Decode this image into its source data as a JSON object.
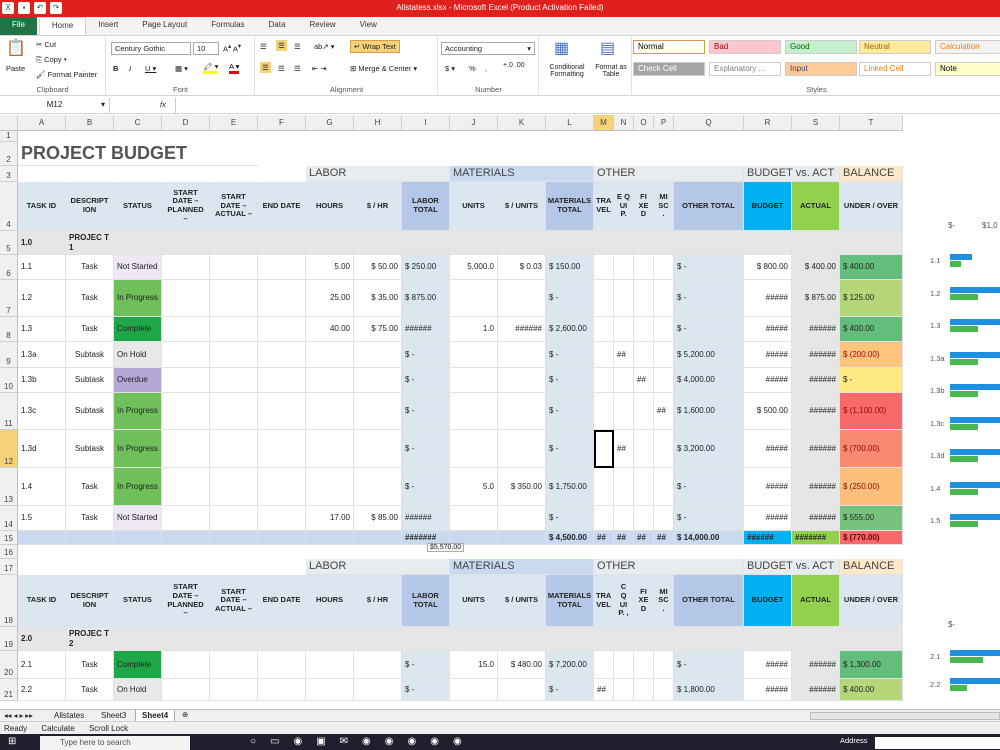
{
  "window": {
    "title": "Allstatess.xlsx  -  Microsoft Excel (Product Activation Failed)"
  },
  "tabs": [
    "File",
    "Home",
    "Insert",
    "Page Layout",
    "Formulas",
    "Data",
    "Review",
    "View"
  ],
  "ribbon": {
    "paste": "Paste",
    "cut": "Cut",
    "copy": "Copy",
    "format_painter": "Format Painter",
    "clipboard": "Clipboard",
    "font_name": "Century Gothic",
    "font_size": "10",
    "font": "Font",
    "wrap": "Wrap Text",
    "merge": "Merge & Center",
    "alignment": "Alignment",
    "number_format": "Accounting",
    "number": "Number",
    "dollar": "$",
    "percent": "%",
    "comma": ",",
    "conditional": "Conditional Formatting",
    "format_table": "Format as Table",
    "styles_label": "Styles",
    "styles": [
      {
        "label": "Normal",
        "bg": "#ffffff",
        "fg": "#000000"
      },
      {
        "label": "Bad",
        "bg": "#ffc7ce",
        "fg": "#9c0006"
      },
      {
        "label": "Good",
        "bg": "#c6efce",
        "fg": "#006100"
      },
      {
        "label": "Neutral",
        "bg": "#ffeb9c",
        "fg": "#9c6500"
      },
      {
        "label": "Calculation",
        "bg": "#f2f2f2",
        "fg": "#fa7d00"
      },
      {
        "label": "Check Cell",
        "bg": "#a5a5a5",
        "fg": "#ffffff"
      },
      {
        "label": "Explanatory ...",
        "bg": "#ffffff",
        "fg": "#7f7f7f"
      },
      {
        "label": "Input",
        "bg": "#ffcc99",
        "fg": "#3f3f76"
      },
      {
        "label": "Linked Cell",
        "bg": "#ffffff",
        "fg": "#fa7d00"
      },
      {
        "label": "Note",
        "bg": "#ffffcc",
        "fg": "#000000"
      }
    ]
  },
  "namebox": "M12",
  "fx": "fx",
  "columns": [
    "A",
    "B",
    "C",
    "D",
    "E",
    "F",
    "G",
    "H",
    "I",
    "J",
    "K",
    "L",
    "M",
    "N",
    "O",
    "P",
    "Q",
    "R",
    "S",
    "T"
  ],
  "rows": [
    "1",
    "2",
    "3",
    "4",
    "5",
    "6",
    "7",
    "8",
    "9",
    "10",
    "11",
    "12",
    "13",
    "14",
    "15",
    "16",
    "17",
    "18",
    "19",
    "20",
    "21"
  ],
  "sheet": {
    "title": "PROJECT BUDGET",
    "sections": {
      "labor": "LABOR",
      "materials": "MATERIALS",
      "other": "OTHER",
      "bva": "BUDGET vs. ACT",
      "balance": "BALANCE"
    },
    "headers": [
      "TASK ID",
      "DESCRIPT ION",
      "STATUS",
      "START DATE – PLANNED –",
      "START DATE – ACTUAL –",
      "END DATE",
      "HOURS",
      "$ / HR",
      "LABOR TOTAL",
      "UNITS",
      "$ / UNITS",
      "MATERIALS TOTAL",
      "TRA VEL",
      "E Q UI P.",
      "FI XE D",
      "MI SC .",
      "OTHER TOTAL",
      "BUDGET",
      "ACTUAL",
      "UNDER / OVER"
    ],
    "headers2": [
      "TASK ID",
      "DESCRIPT ION",
      "STATUS",
      "START DATE – PLANNED –",
      "START DATE – ACTUAL –",
      "END DATE",
      "HOURS",
      "$ / HR",
      "LABOR TOTAL",
      "UNITS",
      "$ / UNITS",
      "MATERIALS TOTAL",
      "TRA VEL",
      "C Q UI P. ,",
      "FI XE D",
      "MI SC .",
      "OTHER TOTAL",
      "BUDGET",
      "ACTUAL",
      "UNDER / OVER"
    ],
    "proj1": {
      "id": "1.0",
      "name": "PROJEC T 1"
    },
    "proj2": {
      "id": "2.0",
      "name": "PROJEC T 2"
    },
    "tasks": [
      {
        "id": "1.1",
        "desc": "Task",
        "status": "Not Started",
        "hours": "5.00",
        "rate": "$   50.00",
        "labor": "$   250.00",
        "units": "5,000.0",
        "unit_cost": "$     0.03",
        "materials": "$      150.00",
        "travel": "",
        "equip": "",
        "fixed": "",
        "misc": "",
        "other": "$            -",
        "budget": "$  800.00",
        "actual": "$  400.00",
        "balance": "$        400.00"
      },
      {
        "id": "1.2",
        "desc": "Task",
        "status": "In Progress",
        "hours": "25.00",
        "rate": "$   35.00",
        "labor": "$   875.00",
        "units": "",
        "unit_cost": "",
        "materials": "$             -",
        "travel": "",
        "equip": "",
        "fixed": "",
        "misc": "",
        "other": "$            -",
        "budget": "#####",
        "actual": "$  875.00",
        "balance": "$        125.00"
      },
      {
        "id": "1.3",
        "desc": "Task",
        "status": "Complete",
        "hours": "40.00",
        "rate": "$   75.00",
        "labor": "######",
        "units": "1.0",
        "unit_cost": "######",
        "materials": "$   2,600.00",
        "travel": "",
        "equip": "",
        "fixed": "",
        "misc": "",
        "other": "$            -",
        "budget": "#####",
        "actual": "######",
        "balance": "$        400.00"
      },
      {
        "id": "1.3a",
        "desc": "Subtask",
        "status": "On Hold",
        "hours": "",
        "rate": "",
        "labor": "$         -",
        "units": "",
        "unit_cost": "",
        "materials": "$             -",
        "travel": "",
        "equip": "##",
        "fixed": "",
        "misc": "",
        "other": "$      5,200.00",
        "budget": "#####",
        "actual": "######",
        "balance": "$      (200.00)"
      },
      {
        "id": "1.3b",
        "desc": "Subtask",
        "status": "Overdue",
        "hours": "",
        "rate": "",
        "labor": "$         -",
        "units": "",
        "unit_cost": "",
        "materials": "$             -",
        "travel": "",
        "equip": "",
        "fixed": "##",
        "misc": "",
        "other": "$      4,000.00",
        "budget": "#####",
        "actual": "######",
        "balance": "$              -"
      },
      {
        "id": "1.3c",
        "desc": "Subtask",
        "status": "In Progress",
        "hours": "",
        "rate": "",
        "labor": "$         -",
        "units": "",
        "unit_cost": "",
        "materials": "$             -",
        "travel": "",
        "equip": "",
        "fixed": "",
        "misc": "##",
        "other": "$      1,600.00",
        "budget": "$  500.00",
        "actual": "######",
        "balance": "$   (1,100.00)"
      },
      {
        "id": "1.3d",
        "desc": "Subtask",
        "status": "In Progress",
        "hours": "",
        "rate": "",
        "labor": "$         -",
        "units": "",
        "unit_cost": "",
        "materials": "$             -",
        "travel": "",
        "equip": "##",
        "fixed": "",
        "misc": "",
        "other": "$      3,200.00",
        "budget": "#####",
        "actual": "######",
        "balance": "$      (700.00)"
      },
      {
        "id": "1.4",
        "desc": "Task",
        "status": "In Progress",
        "hours": "",
        "rate": "",
        "labor": "$         -",
        "units": "5.0",
        "unit_cost": "$  350.00",
        "materials": "$   1,750.00",
        "travel": "",
        "equip": "",
        "fixed": "",
        "misc": "",
        "other": "$            -",
        "budget": "#####",
        "actual": "######",
        "balance": "$      (250.00)"
      },
      {
        "id": "1.5",
        "desc": "Task",
        "status": "Not Started",
        "hours": "17.00",
        "rate": "$   85.00",
        "labor": "######",
        "units": "",
        "unit_cost": "",
        "materials": "$             -",
        "travel": "",
        "equip": "",
        "fixed": "",
        "misc": "",
        "other": "$            -",
        "budget": "#####",
        "actual": "######",
        "balance": "$        555.00"
      }
    ],
    "totals": {
      "labor": "#######",
      "materials": "$   4,500.00",
      "travel": "##",
      "equip": "##",
      "fixed": "##",
      "misc": "##",
      "other": "$     14,000.00",
      "budget": "######",
      "actual": "#######",
      "balance": "$      (770.00)"
    },
    "tooltip": "$5,570.00",
    "tasks2": [
      {
        "id": "2.1",
        "desc": "Task",
        "status": "Complete",
        "units": "15.0",
        "unit_cost": "$  480.00",
        "materials": "$   7,200.00",
        "labor": "$         -",
        "other": "$            -",
        "travel": "",
        "budget": "#####",
        "actual": "######",
        "balance": "$     1,300.00"
      },
      {
        "id": "2.2",
        "desc": "Task",
        "status": "On Hold",
        "units": "",
        "unit_cost": "",
        "materials": "$             -",
        "labor": "$         -",
        "other": "$      1,800.00",
        "travel": "##",
        "budget": "#####",
        "actual": "######",
        "balance": "$        400.00"
      }
    ]
  },
  "chart_data": [
    {
      "type": "bar",
      "categories": [
        "1.1",
        "1.2",
        "1.3",
        "1.3a",
        "1.3b",
        "1.3c",
        "1.3d",
        "1.4",
        "1.5"
      ],
      "x_tick_labels": [
        "$-",
        "$1,0"
      ],
      "series": [
        {
          "values": [
            400,
            1000,
            1000,
            1000,
            1000,
            1000,
            1000,
            1000,
            1000
          ]
        },
        {
          "values": [
            200,
            500,
            500,
            500,
            500,
            500,
            500,
            500,
            500
          ]
        }
      ]
    },
    {
      "type": "bar",
      "categories": [
        "2.1",
        "2.2"
      ],
      "x_tick_labels": [
        "$-"
      ],
      "series": [
        {
          "values": [
            1000,
            900
          ]
        },
        {
          "values": [
            600,
            300
          ]
        }
      ]
    }
  ],
  "sheet_tabs": [
    "Allstates",
    "Sheet3",
    "Sheet4"
  ],
  "status": {
    "ready": "Ready",
    "calculate": "Calculate",
    "scroll": "Scroll Lock"
  },
  "taskbar": {
    "search": "Type here to search",
    "address": "Address"
  }
}
